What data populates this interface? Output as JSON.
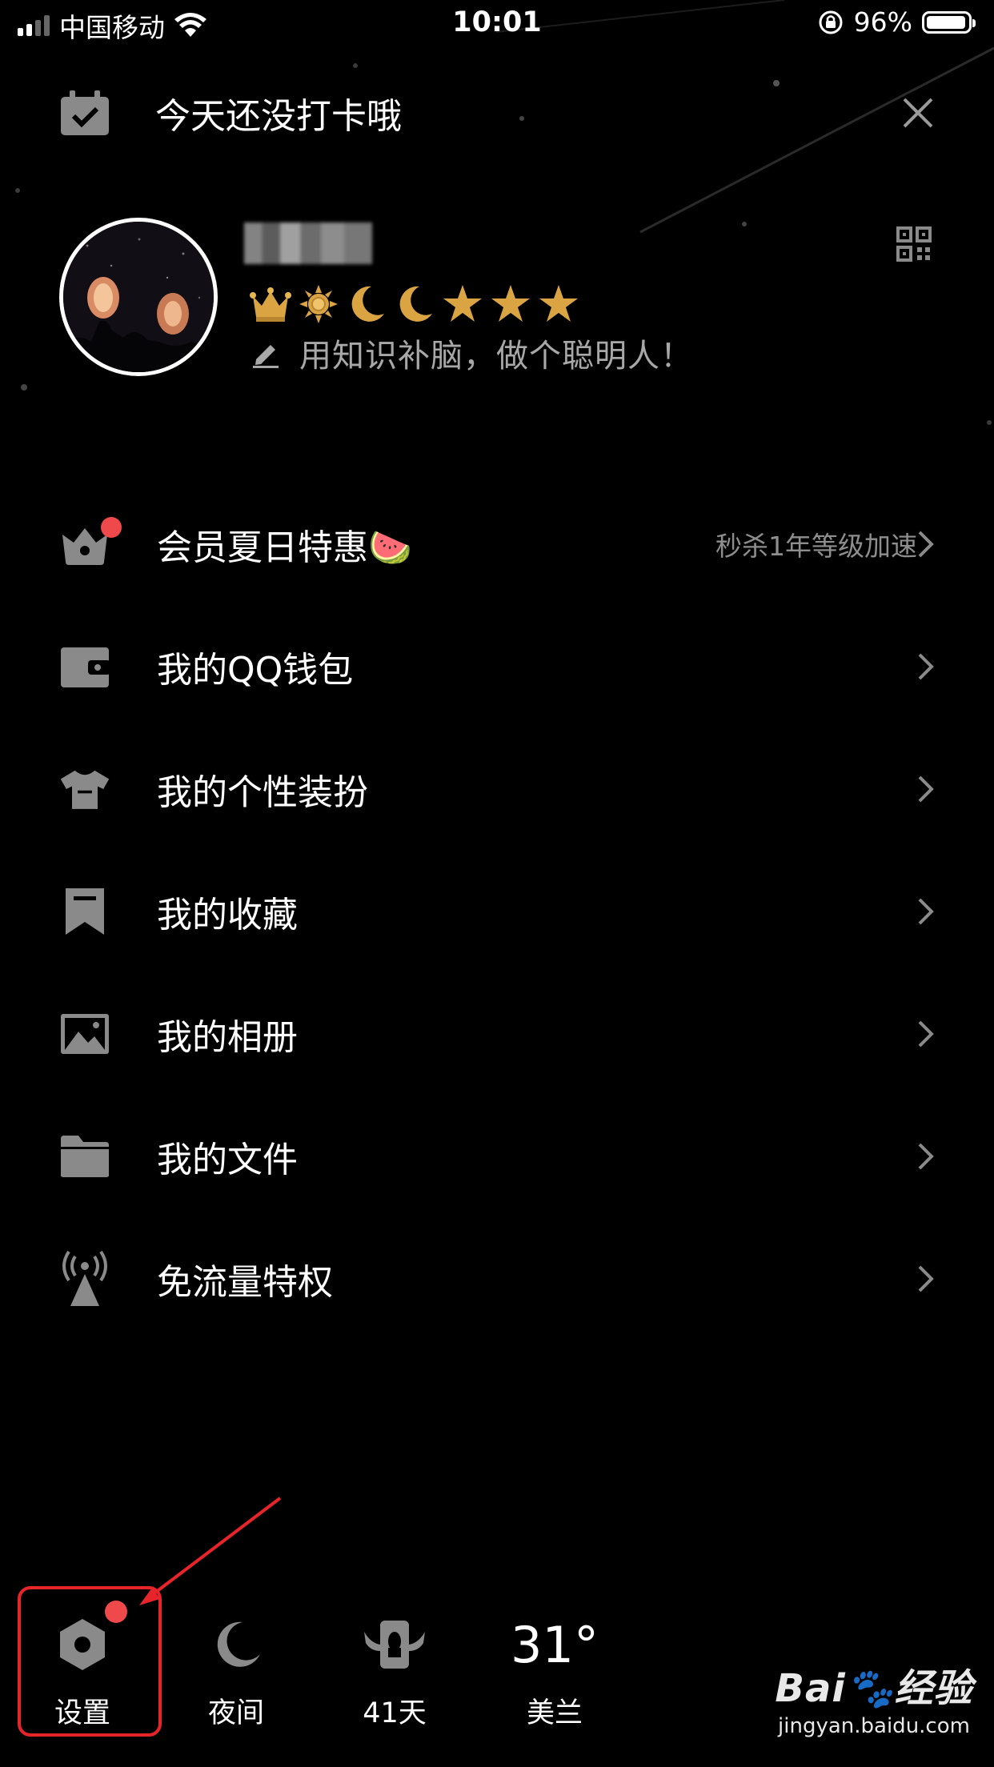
{
  "status_bar": {
    "carrier": "中国移动",
    "time": "10:01",
    "battery_percent": "96%",
    "battery_level": 0.96,
    "signal_bars": 4,
    "signal_bars_lit": 2
  },
  "checkin": {
    "text": "今天还没打卡哦"
  },
  "profile": {
    "signature": "用知识补脑，做个聪明人！",
    "badges": [
      "crown-icon",
      "sun-icon",
      "moon-icon",
      "moon-icon",
      "star-icon",
      "star-icon",
      "star-icon"
    ]
  },
  "menu": {
    "items": [
      {
        "label": "会员夏日特惠🍉",
        "sub": "秒杀1年等级加速",
        "icon": "vip-gift-icon",
        "has_dot": true
      },
      {
        "label": "我的QQ钱包",
        "sub": "",
        "icon": "wallet-icon",
        "has_dot": false
      },
      {
        "label": "我的个性装扮",
        "sub": "",
        "icon": "shirt-icon",
        "has_dot": false
      },
      {
        "label": "我的收藏",
        "sub": "",
        "icon": "bookmark-icon",
        "has_dot": false
      },
      {
        "label": "我的相册",
        "sub": "",
        "icon": "photo-icon",
        "has_dot": false
      },
      {
        "label": "我的文件",
        "sub": "",
        "icon": "folder-icon",
        "has_dot": false
      },
      {
        "label": "免流量特权",
        "sub": "",
        "icon": "signal-tower-icon",
        "has_dot": false
      }
    ]
  },
  "bottom_bar": {
    "settings_label": "设置",
    "night_label": "夜间",
    "days_label": "41天",
    "temperature": "31°",
    "city": "美兰"
  },
  "watermark": {
    "logo": "Bai🐾经验",
    "url": "jingyan.baidu.com"
  },
  "colors": {
    "background": "#000000",
    "icon_gray": "#8a8a8a",
    "red_dot": "#f0494c",
    "annotation_red": "#e8242b"
  }
}
